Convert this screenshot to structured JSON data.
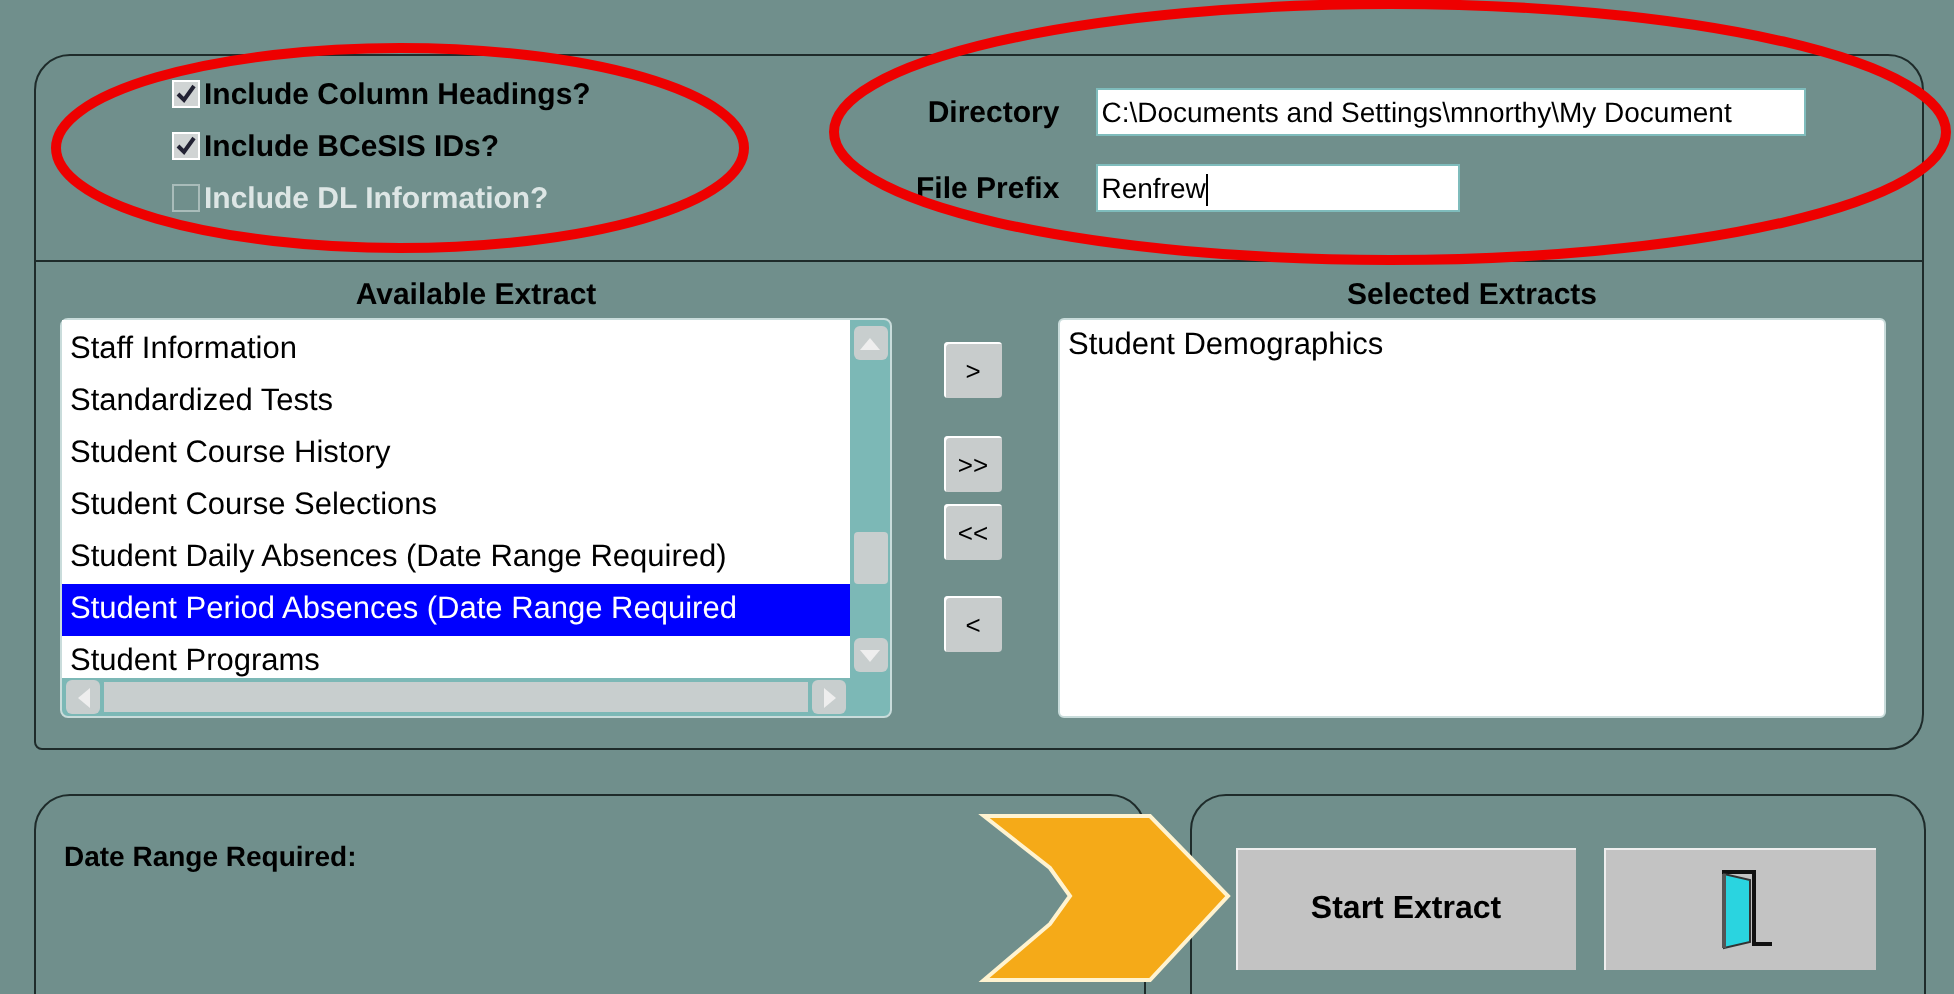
{
  "options": [
    {
      "label": "Include Column Headings?",
      "checked": true,
      "disabled": false
    },
    {
      "label": "Include BCeSIS IDs?",
      "checked": true,
      "disabled": false
    },
    {
      "label": "Include DL Information?",
      "checked": false,
      "disabled": true
    }
  ],
  "directory": {
    "label": "Directory",
    "value": "C:\\Documents and Settings\\mnorthy\\My Document"
  },
  "file_prefix": {
    "label": "File Prefix",
    "value": "Renfrew"
  },
  "available": {
    "title": "Available Extract",
    "items": [
      {
        "label": "Staff Information",
        "selected": false
      },
      {
        "label": "Standardized Tests",
        "selected": false
      },
      {
        "label": "Student Course History",
        "selected": false
      },
      {
        "label": "Student Course Selections",
        "selected": false
      },
      {
        "label": "Student Daily Absences (Date Range Required)",
        "selected": false
      },
      {
        "label": "Student Period Absences (Date Range Required",
        "selected": true
      },
      {
        "label": "Student Programs",
        "selected": false
      }
    ]
  },
  "move_buttons": [
    ">",
    ">>",
    "<<",
    "<"
  ],
  "selected_extracts": {
    "title": "Selected Extracts",
    "items": [
      {
        "label": "Student Demographics",
        "selected": false
      }
    ]
  },
  "date_range": {
    "label": "Date Range Required:"
  },
  "start_button": "Start Extract"
}
